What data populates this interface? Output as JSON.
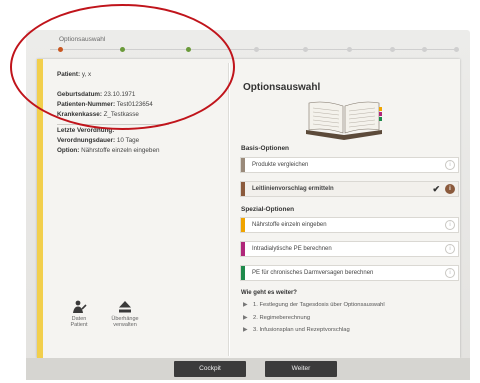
{
  "progress": {
    "label": "Optionsauswahl",
    "steps_done": 3,
    "steps_total": 9
  },
  "patient": {
    "name_label": "Patient:",
    "name_value": "y, x",
    "dob_label": "Geburtsdatum:",
    "dob_value": "23.10.1971",
    "id_label": "Patienten-Nummer:",
    "id_value": "Test0123654",
    "insurance_label": "Krankenkasse:",
    "insurance_value": "Z_Testkasse"
  },
  "order": {
    "heading": "Letzte Verordnung:",
    "duration_label": "Verordnungsdauer:",
    "duration_value": "10 Tage",
    "option_label": "Option:",
    "option_value": "Nährstoffe einzeln eingeben"
  },
  "tools": {
    "patient_data": {
      "line1": "Daten",
      "line2": "Patient"
    },
    "handover": {
      "line1": "Überhänge",
      "line2": "verwalten"
    }
  },
  "main": {
    "title": "Optionsauswahl",
    "basis_heading": "Basis-Optionen",
    "basis_options": [
      {
        "label": "Produkte vergleichen",
        "color": "#9a8a7a"
      },
      {
        "label": "Leitlinienvorschlag ermitteln",
        "color": "#8b5a3c"
      }
    ],
    "special_heading": "Spezial-Optionen",
    "special_options": [
      {
        "label": "Nährstoffe einzeln eingeben",
        "color": "#f0a400"
      },
      {
        "label": "Intradialytische PE berechnen",
        "color": "#b0277a"
      },
      {
        "label": "PE für chronisches Darmversagen berechnen",
        "color": "#1f8a4c"
      }
    ],
    "next_heading": "Wie geht es weiter?",
    "next_steps": [
      "1. Festlegung der Tagesdosis über Optionsauswahl",
      "2. Regimeberechnung",
      "3. Infusionsplan und Rezeptvorschlag"
    ]
  },
  "footer": {
    "cockpit_label": "Cockpit",
    "next_label": "Weiter"
  },
  "colors": {
    "accent": "#f2cf4c",
    "step_done": "#6a9a3a",
    "annotation": "#c0141b"
  }
}
